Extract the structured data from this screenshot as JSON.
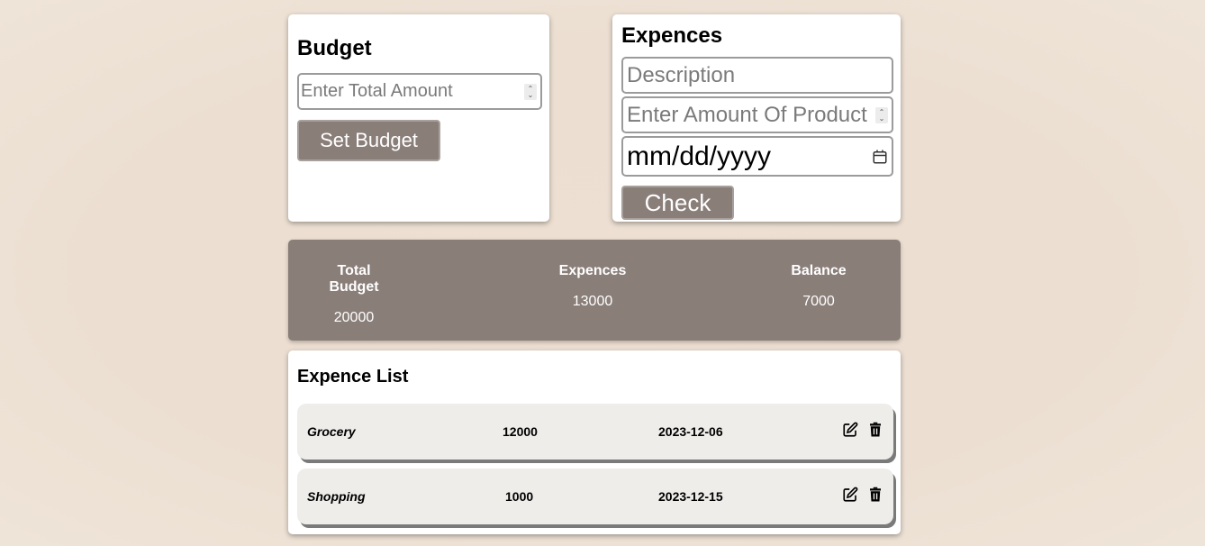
{
  "budget": {
    "title": "Budget",
    "input_placeholder": "Enter Total Amount",
    "button_label": "Set Budget"
  },
  "expense_form": {
    "title": "Expences",
    "description_placeholder": "Description",
    "amount_placeholder": "Enter Amount Of Product",
    "date_placeholder": "mm/dd/yyyy",
    "button_label": "Check"
  },
  "summary": {
    "total_budget_label": "Total Budget",
    "total_budget_value": "20000",
    "expenses_label": "Expences",
    "expenses_value": "13000",
    "balance_label": "Balance",
    "balance_value": "7000"
  },
  "expense_list": {
    "title": "Expence List",
    "items": [
      {
        "name": "Grocery",
        "amount": "12000",
        "date": "2023-12-06"
      },
      {
        "name": "Shopping",
        "amount": "1000",
        "date": "2023-12-15"
      }
    ]
  },
  "icons": {
    "edit": "edit-icon",
    "delete": "trash-icon"
  },
  "colors": {
    "accent": "#8a7e79",
    "background": "#ecdfd2",
    "row_bg": "#efedea"
  }
}
